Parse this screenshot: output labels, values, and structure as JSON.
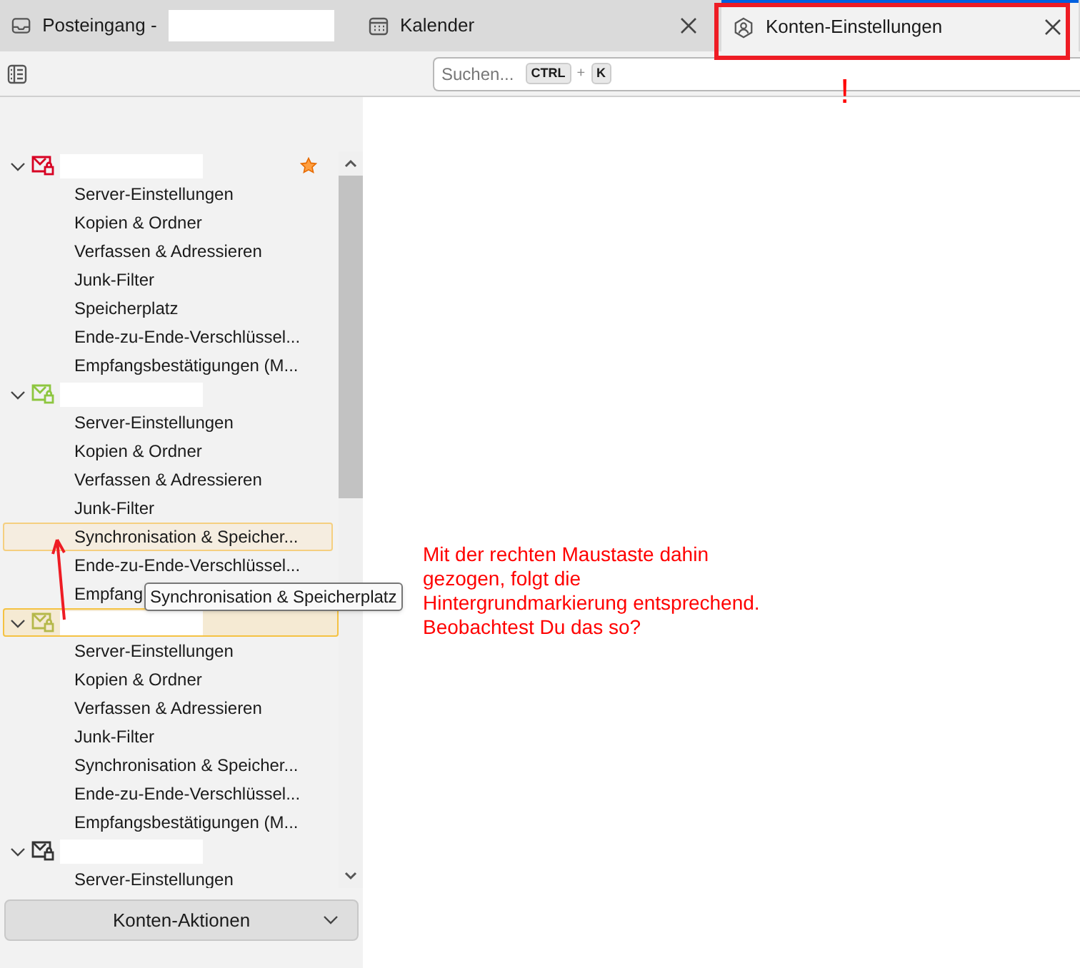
{
  "tabs": [
    {
      "label": "Posteingang -",
      "selected": false,
      "closable": false,
      "redacted": true
    },
    {
      "label": "Kalender",
      "selected": false,
      "closable": true,
      "redacted": false
    },
    {
      "label": "Konten-Einstellungen",
      "selected": true,
      "closable": true,
      "redacted": false
    }
  ],
  "search": {
    "placeholder": "Suchen...",
    "keys": [
      "CTRL",
      "+",
      "K"
    ]
  },
  "accounts": [
    {
      "color": "#d70022",
      "expanded": true,
      "starred": true,
      "hovered": false,
      "items": [
        {
          "label": "Server-Einstellungen",
          "hovered": false
        },
        {
          "label": "Kopien & Ordner",
          "hovered": false
        },
        {
          "label": "Verfassen & Adressieren",
          "hovered": false
        },
        {
          "label": "Junk-Filter",
          "hovered": false
        },
        {
          "label": "Speicherplatz",
          "hovered": false
        },
        {
          "label": "Ende-zu-Ende-Verschlüssel...",
          "hovered": false
        },
        {
          "label": "Empfangsbestätigungen (M...",
          "hovered": false
        }
      ]
    },
    {
      "color": "#8dc63f",
      "expanded": true,
      "starred": false,
      "hovered": false,
      "items": [
        {
          "label": "Server-Einstellungen",
          "hovered": false
        },
        {
          "label": "Kopien & Ordner",
          "hovered": false
        },
        {
          "label": "Verfassen & Adressieren",
          "hovered": false
        },
        {
          "label": "Junk-Filter",
          "hovered": false
        },
        {
          "label": "Synchronisation & Speicher...",
          "hovered": true
        },
        {
          "label": "Ende-zu-Ende-Verschlüssel...",
          "hovered": false
        },
        {
          "label": "Empfang",
          "hovered": false
        }
      ]
    },
    {
      "color": "#b5b84a",
      "expanded": true,
      "starred": false,
      "hovered": true,
      "items": [
        {
          "label": "Server-Einstellungen",
          "hovered": false
        },
        {
          "label": "Kopien & Ordner",
          "hovered": false
        },
        {
          "label": "Verfassen & Adressieren",
          "hovered": false
        },
        {
          "label": "Junk-Filter",
          "hovered": false
        },
        {
          "label": "Synchronisation & Speicher...",
          "hovered": false
        },
        {
          "label": "Ende-zu-Ende-Verschlüssel...",
          "hovered": false
        },
        {
          "label": "Empfangsbestätigungen (M...",
          "hovered": false
        }
      ]
    },
    {
      "color": "#333333",
      "expanded": true,
      "starred": false,
      "hovered": false,
      "items": [
        {
          "label": "Server-Einstellungen",
          "hovered": false
        }
      ]
    }
  ],
  "tooltip": "Synchronisation & Speicherplatz",
  "actions_button": {
    "label": "Konten-Aktionen"
  },
  "annotation": {
    "mark": "!",
    "text": "Mit der rechten Maustaste dahin gezogen, folgt die Hintergrundmarkierung entsprechend. Beobachtest Du das so?"
  }
}
